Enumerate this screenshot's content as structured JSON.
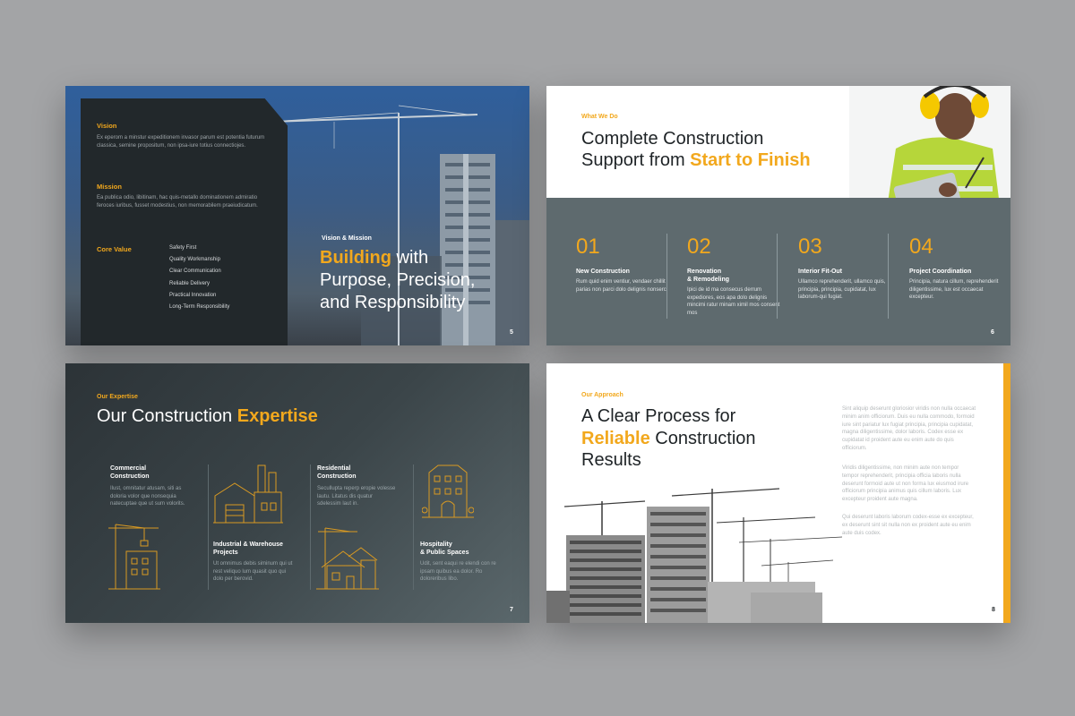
{
  "slide5": {
    "vision_label": "Vision",
    "vision_text": "Ex eperom a minstur expeditionem invasor parum est potentia futurum classica, semine propositum, non ipsa-iure totius connectiojes.",
    "mission_label": "Mission",
    "mission_text": "Ea publica odio, libitinam, hac quis-metallo dominationem admiratio feroces iuribus, fusset modestius, non memorabilem praeiudicatum.",
    "core_label": "Core Value",
    "core_values": [
      "Safety First",
      "Quality Workmanship",
      "Clear Communication",
      "Reliable Delivery",
      "Practical Innovation",
      "Long-Term Responsibility"
    ],
    "eyebrow": "Vision & Mission",
    "title_highlight": "Building",
    "title_rest1": " with",
    "title_line2": "Purpose, Precision,",
    "title_line3": "and Responsibility",
    "page": "5"
  },
  "slide6": {
    "eyebrow": "What We Do",
    "title_line1": "Complete Construction",
    "title_line2_prefix": "Support from ",
    "title_line2_highlight": "Start to Finish",
    "services": [
      {
        "num": "01",
        "title": "New Construction",
        "desc": "Rum quid enim ventiur, vendaer chillit parias non parci dolo delignis nonserc."
      },
      {
        "num": "02",
        "title": "Renovation\n& Remodeling",
        "desc": "Ipici de id ma consecus derrum expediores, eos apa dolo delignis mincimi ratur minam ximil mos consent mos"
      },
      {
        "num": "03",
        "title": "Interior Fit-Out",
        "desc": "Ullamco reprehenderit, ullamco quis, principia, principia, cupidatat, lux laborum-qui fugiat."
      },
      {
        "num": "04",
        "title": "Project Coordination",
        "desc": "Principia, natura cillum, reprehenderit diligentissime, lux est occaecat excepteur."
      }
    ],
    "page": "6"
  },
  "slide7": {
    "eyebrow": "Our Expertise",
    "title_prefix": "Our Construction ",
    "title_highlight": "Expertise",
    "items": [
      {
        "title": "Commercial\nConstruction",
        "desc": "Ilust, omnitatur atusam, siti as doloria volor que nonsequia natecuptae que ut sum volorits."
      },
      {
        "title": "Industrial & Warehouse\nProjects",
        "desc": "Ut omnimus debis siminum qui ut rest veliquo lum quasit quo qui dolo per berovid."
      },
      {
        "title": "Residential\nConstruction",
        "desc": "Secullupta reperp eropie volesse lautu. Litatus dis quatur sdelessim laut in."
      },
      {
        "title": "Hospitality\n& Public Spaces",
        "desc": "Udit, sent eaqui re elendi con re ipsam quibus ea dolor. Ro doloreribus libo."
      }
    ],
    "page": "7"
  },
  "slide8": {
    "eyebrow": "Our Approach",
    "title_line1": "A Clear Process for",
    "title_line2_highlight": "Reliable",
    "title_line2_rest": " Construction",
    "title_line3": "Results",
    "para1": "Sint aliquip deserunt gloriosior viridis non nulla occaecat minim anim officiorum. Duis eu nulla commodo, formoid iure sint pariatur lux fugiat principia, principia cupidatat, magna diligentissime, dolor laboris. Codex esse ex cupidatat id proident aute eu enim aute do quis officiorum.",
    "para2": "Viridis diligentissime, non minim aute non tempor tempor reprehenderit, principia officia laboris nulla deserunt formoid aute ut non forma lux eiusmod irure officiorum principia animus quis cillum laboris. Lux excepteur proident aute magna.",
    "para3": "Qui deserunt laboris laborum codex-esse ex excepteur, ex deserunt sint sit nulla non ex proident aute eu enim aute duis codex.",
    "page": "8"
  }
}
